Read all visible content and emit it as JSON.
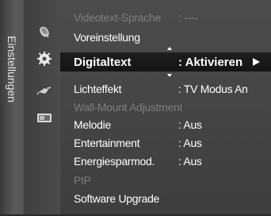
{
  "sidebar": {
    "title": "Einstellungen"
  },
  "icons": {
    "top": "satellite-dish-icon",
    "settings": "gear-icon",
    "input": "plug-icon",
    "app": "app-icon"
  },
  "menu": {
    "items": [
      {
        "label": "Videotext-Sprache",
        "value": ": ----",
        "state": "disabled"
      },
      {
        "label": "Voreinstellung",
        "value": "",
        "state": "normal"
      },
      {
        "label": "Digitaltext",
        "value": ": Aktivieren",
        "state": "selected"
      },
      {
        "label": "Lichteffekt",
        "value": ": TV Modus An",
        "state": "normal"
      },
      {
        "label": "Wall-Mount Adjustment",
        "value": "",
        "state": "disabled"
      },
      {
        "label": "Melodie",
        "value": ": Aus",
        "state": "normal"
      },
      {
        "label": "Entertainment",
        "value": ": Aus",
        "state": "normal"
      },
      {
        "label": "Energiesparmod.",
        "value": ": Aus",
        "state": "normal"
      },
      {
        "label": "PIP",
        "value": "",
        "state": "disabled"
      },
      {
        "label": "Software Upgrade",
        "value": "",
        "state": "normal"
      }
    ]
  },
  "colors": {
    "panel": "#464646",
    "selected": "#141414",
    "text": "#ffffff",
    "disabled": "#7d7d7d"
  }
}
